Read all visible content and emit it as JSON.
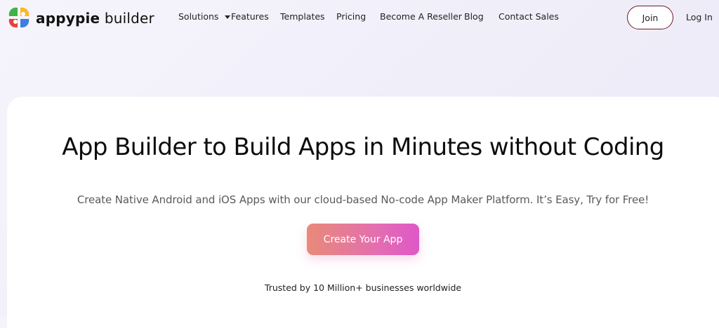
{
  "brand": {
    "name_bold": "appypie",
    "name_rest": " builder",
    "logo_icon": "appypie-logo-icon"
  },
  "nav": {
    "items": [
      {
        "label": "Solutions",
        "has_dropdown": true
      },
      {
        "label": "Features"
      },
      {
        "label": "Templates"
      },
      {
        "label": "Pricing"
      },
      {
        "label": "Become A Reseller"
      },
      {
        "label": "Blog"
      },
      {
        "label": "Contact Sales"
      }
    ],
    "join_label": "Join",
    "login_label": "Log In"
  },
  "hero": {
    "title": "App Builder to Build Apps in Minutes without Coding",
    "subtitle": "Create Native Android and iOS Apps with our cloud-based No-code App Maker Platform. It’s Easy, Try for Free!",
    "cta_label": "Create Your App",
    "trusted_text": "Trusted by 10 Million+ businesses worldwide"
  },
  "colors": {
    "join_border": "#6b1a2a",
    "cta_gradient_start": "#e88a78",
    "cta_gradient_end": "#df58c8"
  }
}
